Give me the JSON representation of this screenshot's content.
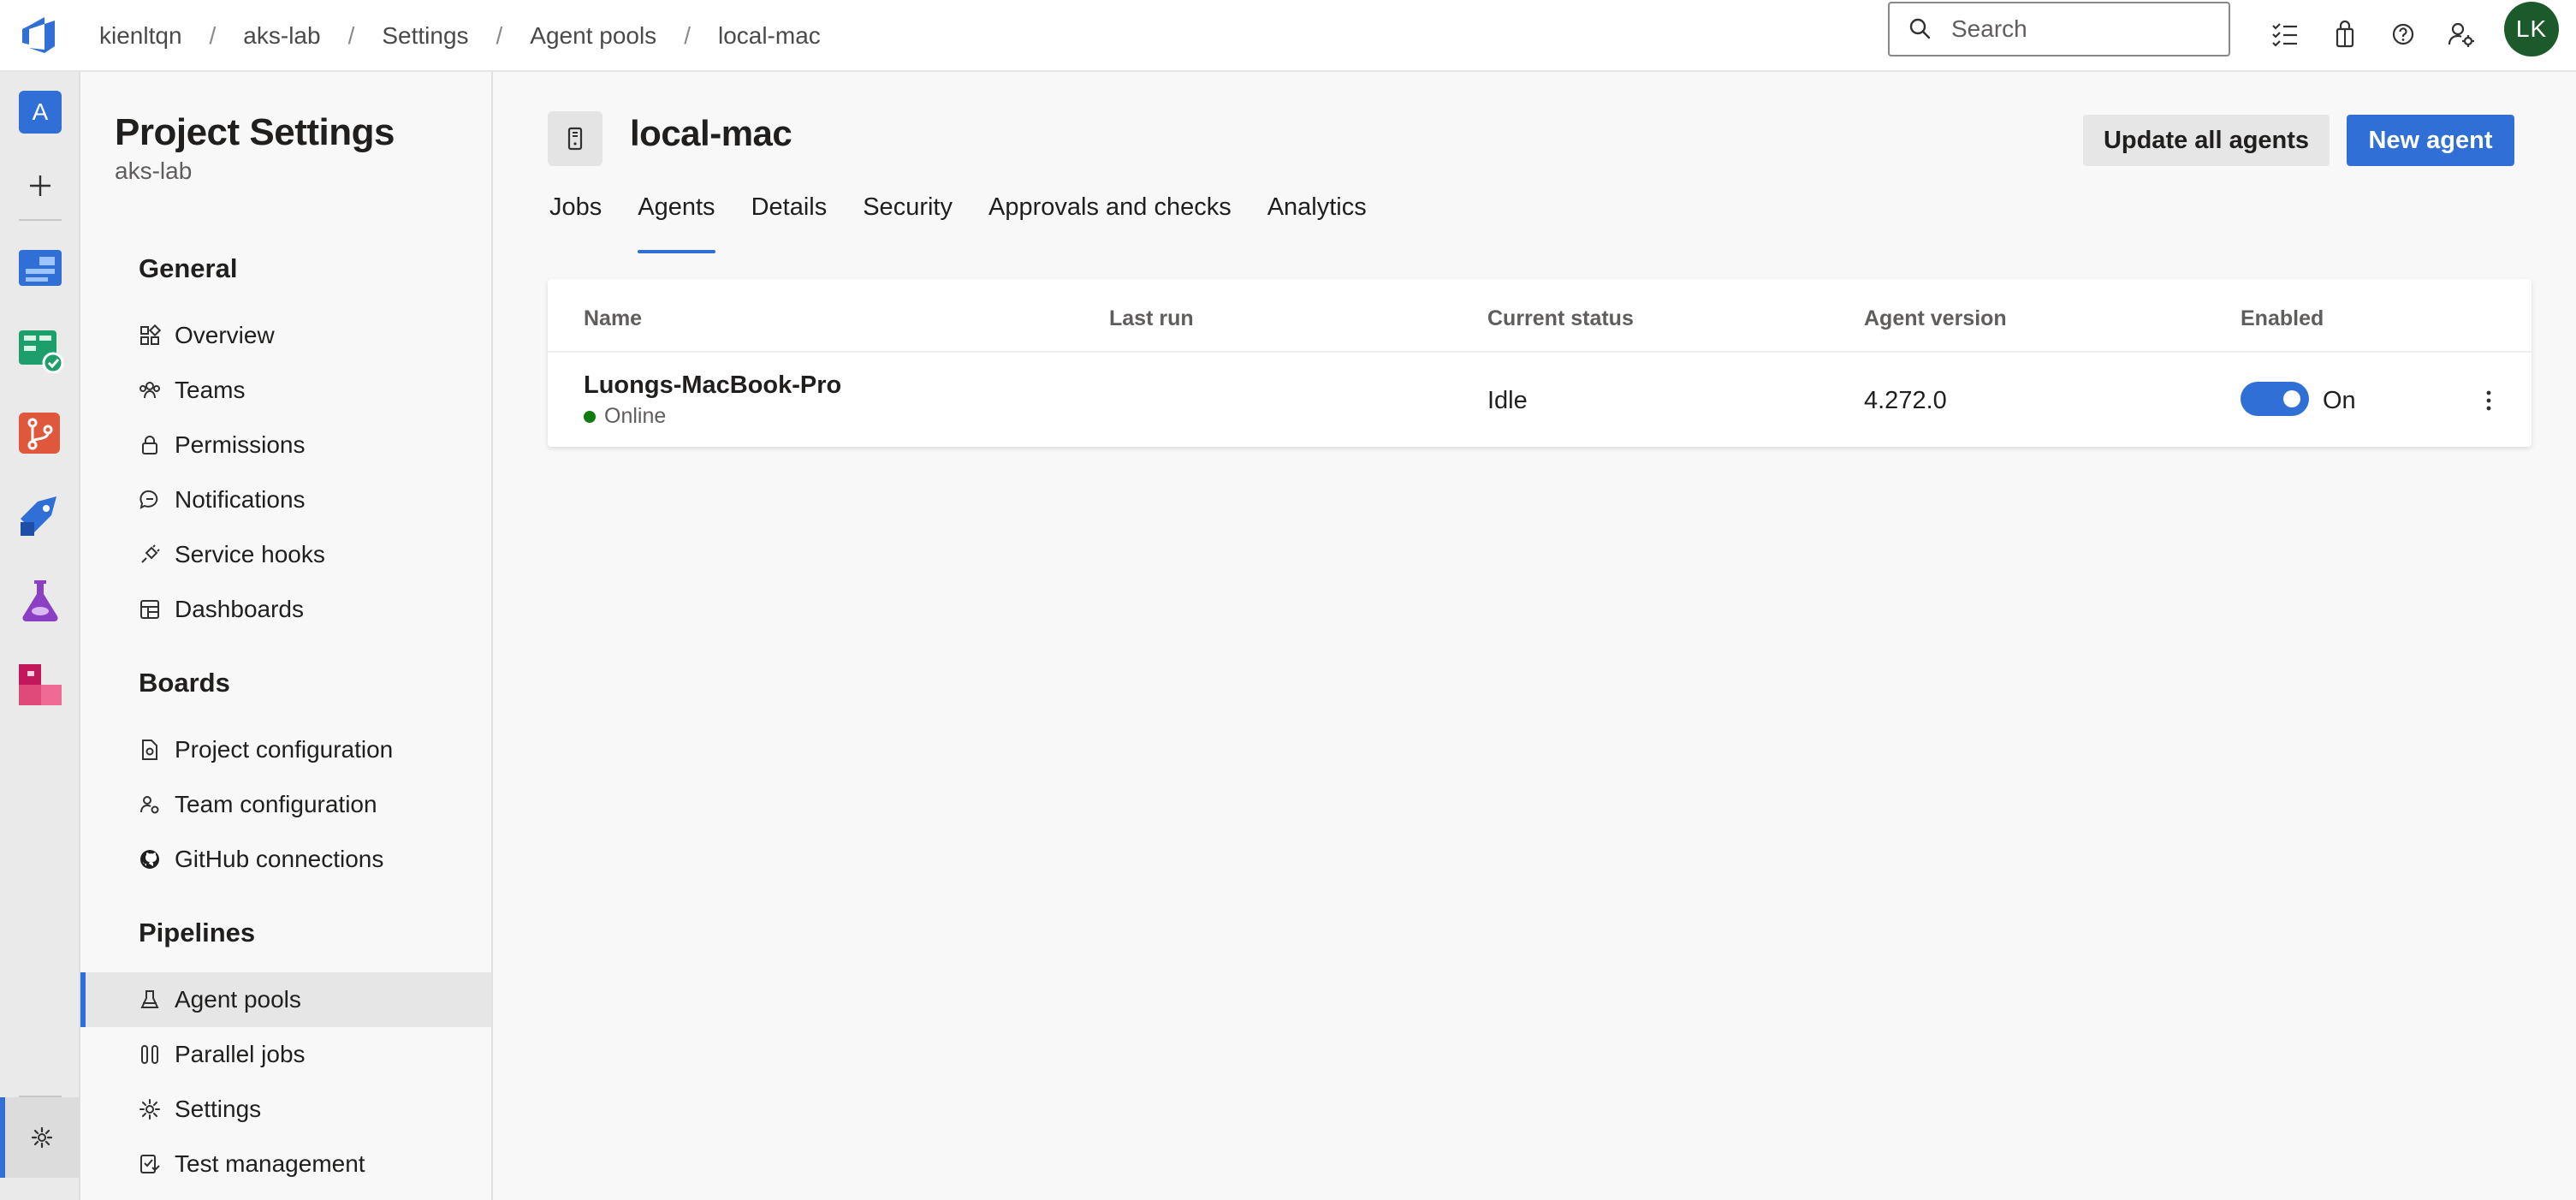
{
  "breadcrumb": [
    "kienltqn",
    "aks-lab",
    "Settings",
    "Agent pools",
    "local-mac"
  ],
  "search": {
    "placeholder": "Search"
  },
  "user": {
    "initials": "LK",
    "avatar_color": "#1d5a2b"
  },
  "org": {
    "initial": "A"
  },
  "sidebar": {
    "title": "Project Settings",
    "subtitle": "aks-lab",
    "groups": [
      {
        "heading": "General",
        "items": [
          "Overview",
          "Teams",
          "Permissions",
          "Notifications",
          "Service hooks",
          "Dashboards"
        ]
      },
      {
        "heading": "Boards",
        "items": [
          "Project configuration",
          "Team configuration",
          "GitHub connections"
        ]
      },
      {
        "heading": "Pipelines",
        "items": [
          "Agent pools",
          "Parallel jobs",
          "Settings",
          "Test management"
        ]
      }
    ]
  },
  "pool": {
    "name": "local-mac"
  },
  "actions": {
    "update_all": "Update all agents",
    "new_agent": "New agent"
  },
  "tabs": [
    "Jobs",
    "Agents",
    "Details",
    "Security",
    "Approvals and checks",
    "Analytics"
  ],
  "active_tab": "Agents",
  "table": {
    "columns": [
      "Name",
      "Last run",
      "Current status",
      "Agent version",
      "Enabled"
    ],
    "rows": [
      {
        "name": "Luongs-MacBook-Pro",
        "state": "Online",
        "last_run": "",
        "status": "Idle",
        "version": "4.272.0",
        "enabled": "On"
      }
    ]
  },
  "colors": {
    "accent": "#2f6fd6",
    "online": "#107c10"
  }
}
